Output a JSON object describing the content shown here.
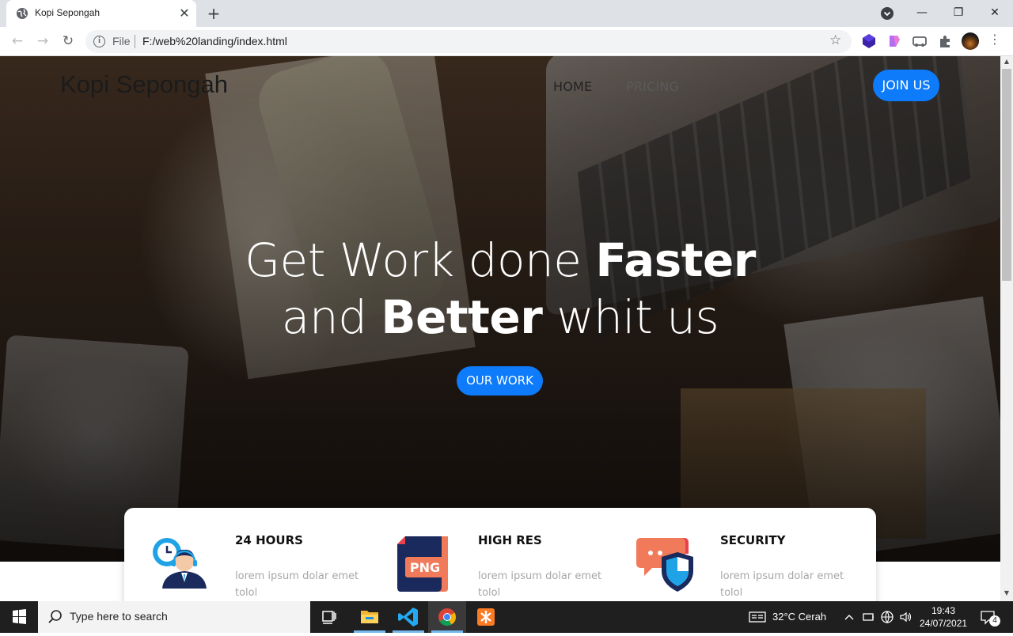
{
  "browser": {
    "tab_title": "Kopi Sepongah",
    "tab_close": "✕",
    "new_tab": "+",
    "window_controls": {
      "minimize": "—",
      "restore": "❐",
      "close": "✕"
    },
    "nav": {
      "back": "←",
      "forward": "→",
      "reload": "↻"
    },
    "omnibox": {
      "info": "i",
      "scheme_label": "File",
      "url": "F:/web%20landing/index.html"
    },
    "bookmark": "☆",
    "menu": "⋮",
    "extensions": [
      "purple-cube-icon",
      "gradient-extension-icon",
      "cast-icon",
      "puzzle-extensions-icon"
    ]
  },
  "site": {
    "brand": "Kopi Sepongah",
    "nav": [
      {
        "label": "HOME"
      },
      {
        "label": "PRICING"
      }
    ],
    "join_label": "JOIN US",
    "headline": {
      "part1": "Get Work done ",
      "bold1": "Faster",
      "part2": "and ",
      "bold2": "Better",
      "part3": " whit us"
    },
    "cta_label": "OUR WORK",
    "features": [
      {
        "title": "24 HOURS",
        "text": "lorem ipsum dolar emet tolol",
        "icon": "clock-support-agent-icon"
      },
      {
        "title": "HIGH RES",
        "text": "lorem ipsum dolar emet tolol",
        "icon": "png-file-icon",
        "icon_text": "PNG"
      },
      {
        "title": "SECURITY",
        "text": "lorem ipsum dolar emet tolol",
        "icon": "chat-shield-icon"
      }
    ],
    "colors": {
      "accent": "#0d7bfa",
      "feature_text": "#a7a7a7"
    }
  },
  "taskbar": {
    "search_placeholder": "Type here to search",
    "apps": [
      "task-view-icon",
      "file-explorer-icon",
      "vscode-icon",
      "chrome-icon",
      "xampp-icon"
    ],
    "weather": "32°C  Cerah",
    "time": "19:43",
    "date": "24/07/2021",
    "notifications": "4"
  }
}
